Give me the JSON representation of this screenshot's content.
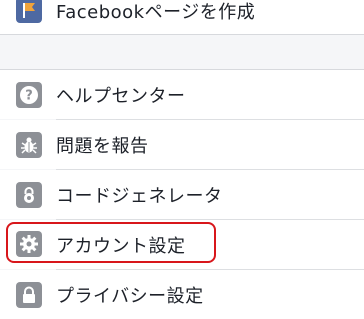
{
  "menu": {
    "top_item": {
      "label": "Facebookページを作成",
      "icon": "flag-icon",
      "icon_color": "#3b5998"
    },
    "items": [
      {
        "label": "ヘルプセンター",
        "icon": "help-icon"
      },
      {
        "label": "問題を報告",
        "icon": "bug-icon"
      },
      {
        "label": "コードジェネレータ",
        "icon": "lock-code-icon"
      },
      {
        "label": "アカウント設定",
        "icon": "gear-icon",
        "highlighted": true
      },
      {
        "label": "プライバシー設定",
        "icon": "lock-icon"
      }
    ],
    "highlight_color": "#d8161b"
  }
}
